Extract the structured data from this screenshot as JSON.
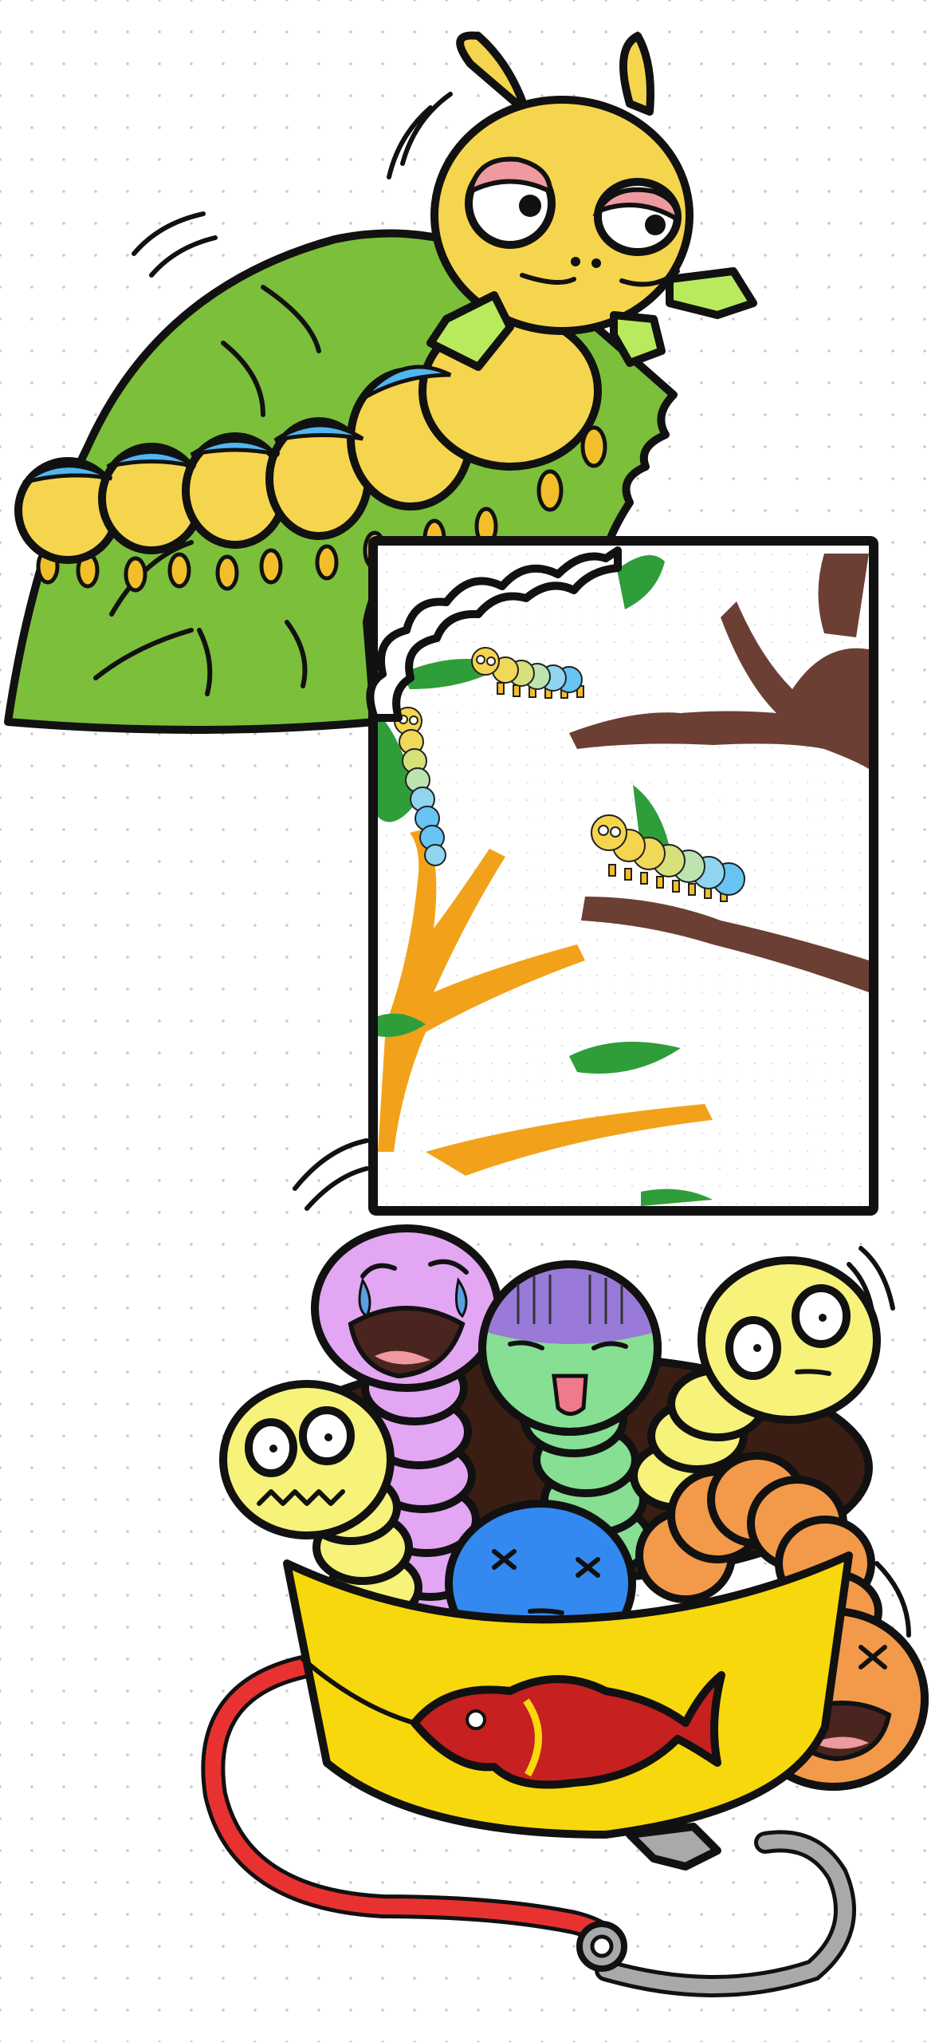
{
  "canvas": {
    "background": "#ffffff",
    "dot_color": "#c9c9c9"
  },
  "palette": {
    "caterpillar_body": "#f6d54e",
    "caterpillar_stripe": "#4fb6f0",
    "leaf_green": "#7cbf3a",
    "branch_brown": "#6b3f33",
    "branch_orange": "#f2a21a",
    "bucket_yellow": "#f7d80d",
    "fish_red": "#c62020",
    "hook_gray": "#a9a9a9",
    "rope_red": "#e83232"
  },
  "icons": [
    "caterpillar-icon",
    "leaf-icon",
    "tree-branch-icon",
    "worm-icon",
    "bait-bucket-icon",
    "fish-icon",
    "fishing-hook-icon"
  ],
  "worms": [
    {
      "color": "#e2a6f2",
      "expression": "crying"
    },
    {
      "color": "#86df93",
      "expression": "sick"
    },
    {
      "color": "#f6f27a",
      "expression": "shocked"
    },
    {
      "color": "#f6f27a",
      "expression": "scared"
    },
    {
      "color": "#3389f0",
      "expression": "knocked-out"
    },
    {
      "color": "#f29a4a",
      "expression": "knocked-out"
    }
  ]
}
